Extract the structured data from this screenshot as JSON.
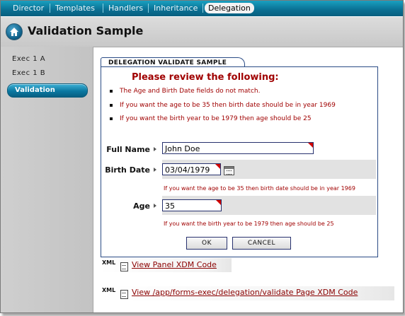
{
  "nav": {
    "tabs": [
      "Director",
      "Templates",
      "Handlers",
      "Inheritance",
      "Delegation"
    ],
    "active": "Delegation"
  },
  "header": {
    "title": "Validation Sample"
  },
  "sidebar": {
    "items": [
      {
        "label": "Exec 1 A"
      },
      {
        "label": "Exec 1 B"
      },
      {
        "label": "Validation"
      }
    ]
  },
  "panel": {
    "tab_label": "DELEGATION VALIDATE SAMPLE",
    "review_heading": "Please review the following:",
    "errors": [
      "The Age and Birth Date fields do not match.",
      "If you want the age to be 35 then birth date should be in year 1969",
      "If you want the birth year to be 1979 then age should be 25"
    ],
    "fields": {
      "full_name": {
        "label": "Full Name",
        "value": "John Doe"
      },
      "birth_date": {
        "label": "Birth Date",
        "value": "03/04/1979",
        "error": "If you want the age to be 35 then birth date should be in year 1969"
      },
      "age": {
        "label": "Age",
        "value": "35",
        "error": "If you want the birth year to be 1979 then age should be 25"
      }
    },
    "buttons": {
      "ok": "OK",
      "cancel": "CANCEL"
    }
  },
  "links": {
    "panel_xdm": "View Panel XDM Code",
    "page_xdm": "View /app/forms-exec/delegation/validate Page XDM Code",
    "xml_badge": "XML"
  },
  "colors": {
    "nav": "#0a7ea2",
    "error": "#a00000",
    "border": "#2a4b85"
  },
  "icons": {
    "home": "home-icon",
    "calendar": "calendar-icon",
    "xml": "xml-doc-icon"
  }
}
